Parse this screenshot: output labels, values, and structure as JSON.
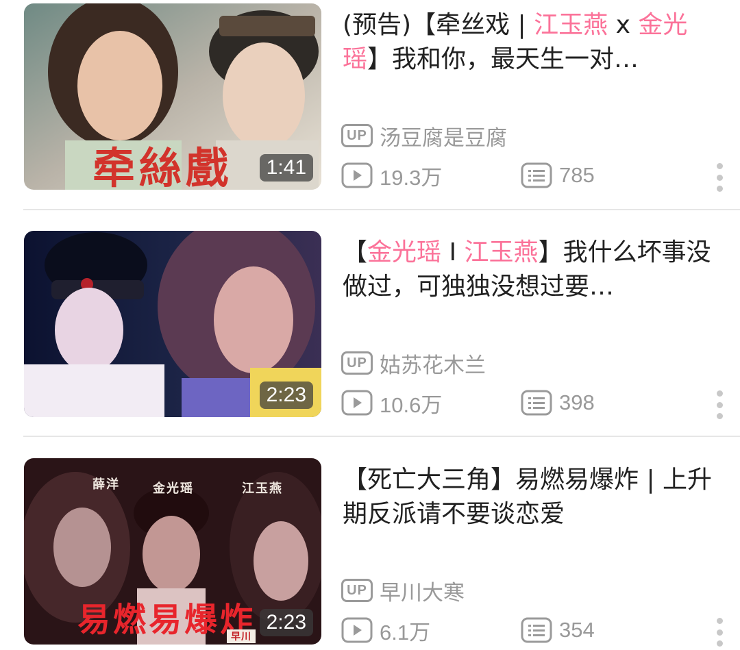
{
  "colors": {
    "highlight": "#fb7299",
    "meta": "#999999",
    "divider": "#e6e6e6"
  },
  "videos": [
    {
      "title_parts": [
        {
          "text": "(预告)【牵丝戏 | ",
          "hl": false
        },
        {
          "text": "江玉燕",
          "hl": true
        },
        {
          "text": " x ",
          "hl": false
        },
        {
          "text": "金光瑶",
          "hl": true
        },
        {
          "text": "】我和你，最天生一对…",
          "hl": false
        }
      ],
      "duration": "1:41",
      "uploader": "汤豆腐是豆腐",
      "views": "19.3万",
      "danmaku": "785",
      "thumb_caption": "牵絲戲"
    },
    {
      "title_parts": [
        {
          "text": "【",
          "hl": false
        },
        {
          "text": "金光瑶",
          "hl": true
        },
        {
          "text": " I ",
          "hl": false
        },
        {
          "text": "江玉燕",
          "hl": true
        },
        {
          "text": "】我什么坏事没做过，可独独没想过要…",
          "hl": false
        }
      ],
      "duration": "2:23",
      "uploader": "姑苏花木兰",
      "views": "10.6万",
      "danmaku": "398"
    },
    {
      "title_parts": [
        {
          "text": "【死亡大三角】易燃易爆炸 | 上升期反派请不要谈恋爱",
          "hl": false
        }
      ],
      "duration": "2:23",
      "uploader": "早川大寒",
      "views": "6.1万",
      "danmaku": "354",
      "thumb_caption": "易燃易爆炸",
      "thumb_names": [
        "薛洋",
        "金光瑶",
        "江玉燕"
      ],
      "thumb_badge": "早川"
    }
  ],
  "icons": {
    "uploader_badge": "UP",
    "views": "play-icon",
    "danmaku": "danmaku-icon",
    "more": "more-vertical-icon"
  }
}
